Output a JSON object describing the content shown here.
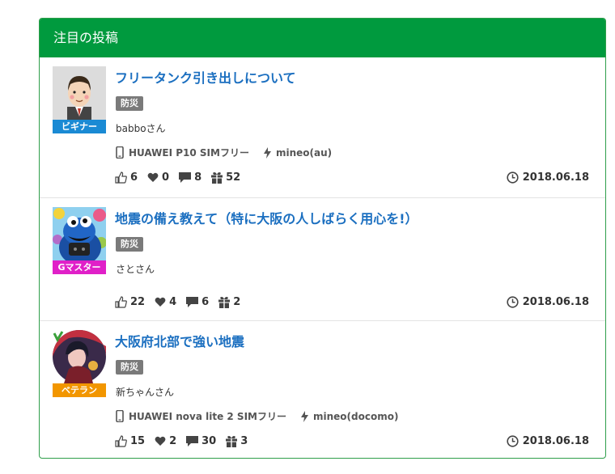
{
  "panel": {
    "title": "注目の投稿"
  },
  "posts": [
    {
      "title": "フリータンク引き出しについて",
      "tag": "防災",
      "author": "babboさん",
      "rank": "ビギナー",
      "rank_color": "#1a8ad4",
      "avatar": "businessman-avatar",
      "device": "HUAWEI P10 SIMフリー",
      "carrier": "mineo(au)",
      "likes": "6",
      "hearts": "0",
      "comments": "8",
      "gifts": "52",
      "date": "2018.06.18"
    },
    {
      "title": "地震の備え教えて（特に大阪の人しばらく用心を!）",
      "tag": "防災",
      "author": "さとさん",
      "rank": "Gマスター",
      "rank_color": "#e020c8",
      "avatar": "blue-monster-avatar",
      "likes": "22",
      "hearts": "4",
      "comments": "6",
      "gifts": "2",
      "date": "2018.06.18"
    },
    {
      "title": "大阪府北部で強い地震",
      "tag": "防災",
      "author": "新ちゃんさん",
      "rank": "ベテラン",
      "rank_color": "#f29600",
      "avatar": "anime-character-avatar",
      "device": "HUAWEI nova lite 2 SIMフリー",
      "carrier": "mineo(docomo)",
      "likes": "15",
      "hearts": "2",
      "comments": "30",
      "gifts": "3",
      "date": "2018.06.18"
    }
  ]
}
